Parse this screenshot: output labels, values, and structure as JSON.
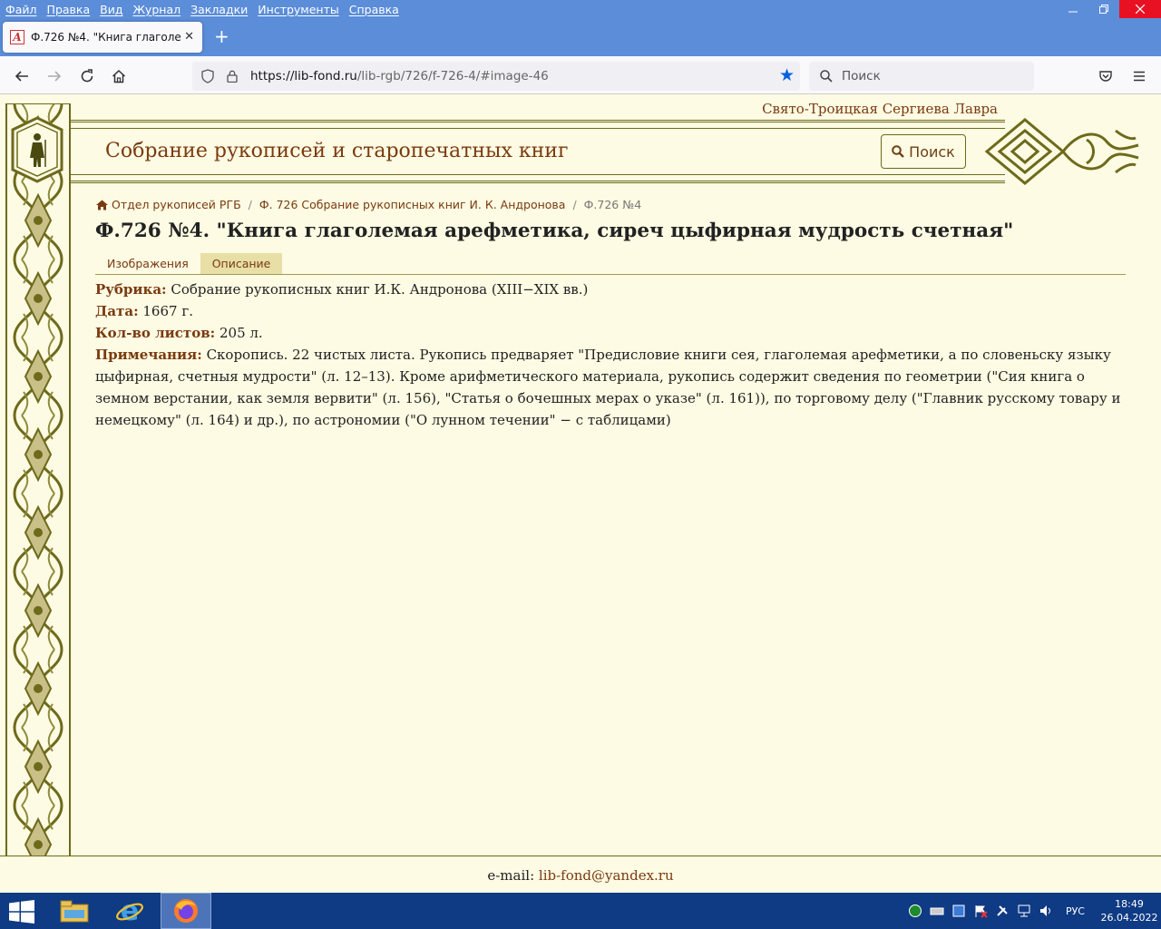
{
  "browser": {
    "menu": [
      "Файл",
      "Правка",
      "Вид",
      "Журнал",
      "Закладки",
      "Инструменты",
      "Справка"
    ],
    "tab_title": "Ф.726 №4. \"Книга глаголемая арефметика, сиреч цыфирная мудрость счетная\"",
    "tab_close": "✕",
    "new_tab": "+",
    "url_host": "https://lib-fond.ru",
    "url_path": "/lib-rgb/726/f-726-4/#image-46",
    "search_placeholder": "Поиск"
  },
  "site": {
    "lavra": "Свято-Троицкая Сергиева Лавра",
    "title": "Собрание рукописей и старопечатных книг",
    "search_button": "Поиск"
  },
  "breadcrumb": {
    "home": "Отдел рукописей РГБ",
    "collection": "Ф. 726 Собрание рукописных книг И. К. Андронова",
    "current": "Ф.726 №4",
    "sep": "/"
  },
  "heading": "Ф.726 №4. \"Книга глаголемая арефметика, сиреч цыфирная мудрость счетная\"",
  "tabs": [
    "Изображения",
    "Описание"
  ],
  "description": {
    "rubric_label": "Рубрика:",
    "rubric": "Собрание рукописных книг И.К. Андронова (XIII−XIX вв.)",
    "date_label": "Дата:",
    "date": "1667 г.",
    "sheets_label": "Кол-во листов:",
    "sheets": "205 л.",
    "notes_label": "Примечания:",
    "notes": "Скоропись. 22 чистых листа. Рукопись предваряет \"Предисловие книги сея, глаголемая арефметики, а по словеньску языку цыфирная, счетныя мудрости\" (л. 12–13). Кроме арифметического материала, рукопись содержит сведения по геометрии (\"Сия книга о земном верстании, как земля вервити\" (л. 156), \"Статья о бочешных мерах о указе\" (л. 161)), по торговому делу (\"Главник русскому товару и немецкому\" (л. 164) и др.), по астрономии (\"О лунном течении\" − с таблицами)"
  },
  "footer": {
    "label": "e-mail:",
    "email": "lib-fond@yandex.ru"
  },
  "taskbar": {
    "lang": "РУС",
    "time": "18:49",
    "date": "26.04.2022"
  }
}
